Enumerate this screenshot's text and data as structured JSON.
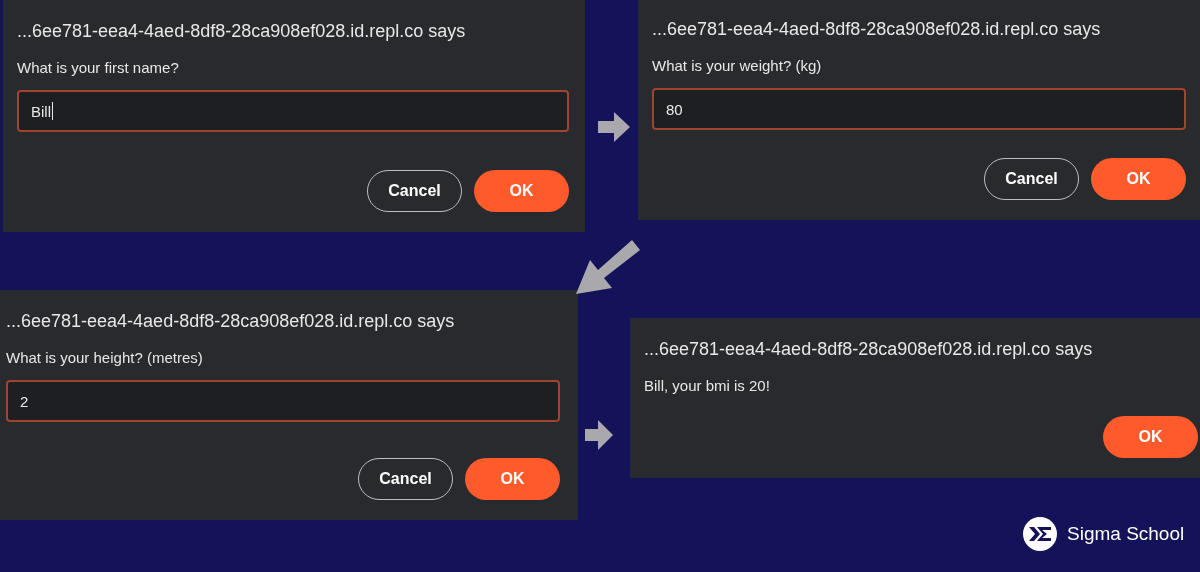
{
  "dialogs": [
    {
      "origin": "...6ee781-eea4-4aed-8df8-28ca908ef028.id.repl.co says",
      "prompt": "What is your first name?",
      "input": {
        "value": "Bill",
        "focused": true
      },
      "buttons": [
        {
          "label": "Cancel",
          "kind": "secondary"
        },
        {
          "label": "OK",
          "kind": "primary"
        }
      ]
    },
    {
      "origin": "...6ee781-eea4-4aed-8df8-28ca908ef028.id.repl.co says",
      "prompt": "What is your weight? (kg)",
      "input": {
        "value": "80",
        "focused": false
      },
      "buttons": [
        {
          "label": "Cancel",
          "kind": "secondary"
        },
        {
          "label": "OK",
          "kind": "primary"
        }
      ]
    },
    {
      "origin": "...6ee781-eea4-4aed-8df8-28ca908ef028.id.repl.co says",
      "prompt": "What is your height? (metres)",
      "input": {
        "value": "2",
        "focused": false
      },
      "buttons": [
        {
          "label": "Cancel",
          "kind": "secondary"
        },
        {
          "label": "OK",
          "kind": "primary"
        }
      ]
    },
    {
      "origin": "...6ee781-eea4-4aed-8df8-28ca908ef028.id.repl.co says",
      "prompt": "Bill, your bmi is 20!",
      "buttons": [
        {
          "label": "OK",
          "kind": "primary"
        }
      ]
    }
  ],
  "brand": {
    "name": "Sigma School"
  }
}
